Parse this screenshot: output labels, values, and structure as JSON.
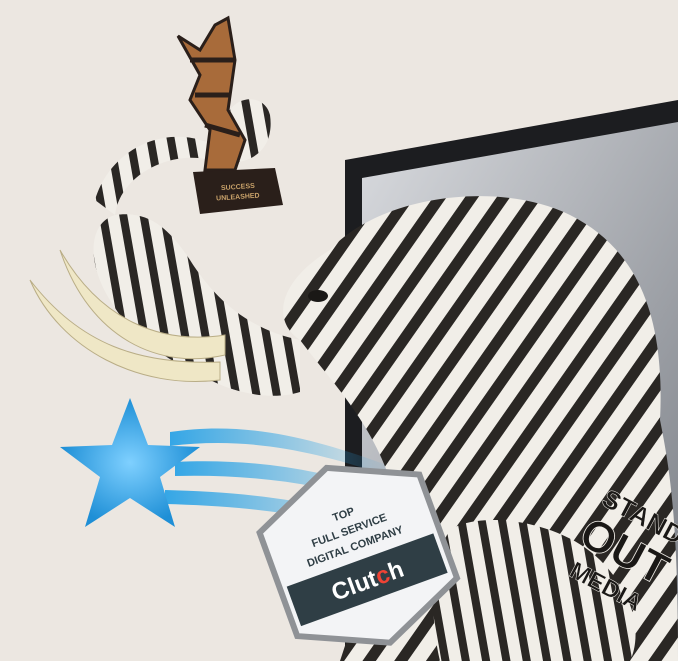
{
  "colors": {
    "background": "#ece7e1",
    "monitor_frame": "#1c1d20",
    "monitor_screen": "#c9ccd1",
    "star": "#2ba3e6",
    "badge_fill": "#f3f4f6",
    "badge_border": "#8f9296",
    "clutch_bar": "#2f3e45",
    "clutch_dot": "#ef4335",
    "tusk": "#efe7c6",
    "trophy_dark": "#2a1f1a",
    "trophy_bronze": "#a86b3a"
  },
  "trophy": {
    "plaque_line1": "SUCCESS",
    "plaque_line2": "UNLEASHED",
    "icon": "trophy-icon"
  },
  "badge": {
    "line1": "TOP",
    "line2": "FULL SERVICE",
    "line3": "DIGITAL COMPANY",
    "brand_before_dot": "Clut",
    "brand_dot_letter": "c",
    "brand_after_dot": "h"
  },
  "tattoo": {
    "line1": "STAND",
    "line2": "OUT",
    "line3": "MEDIA"
  }
}
